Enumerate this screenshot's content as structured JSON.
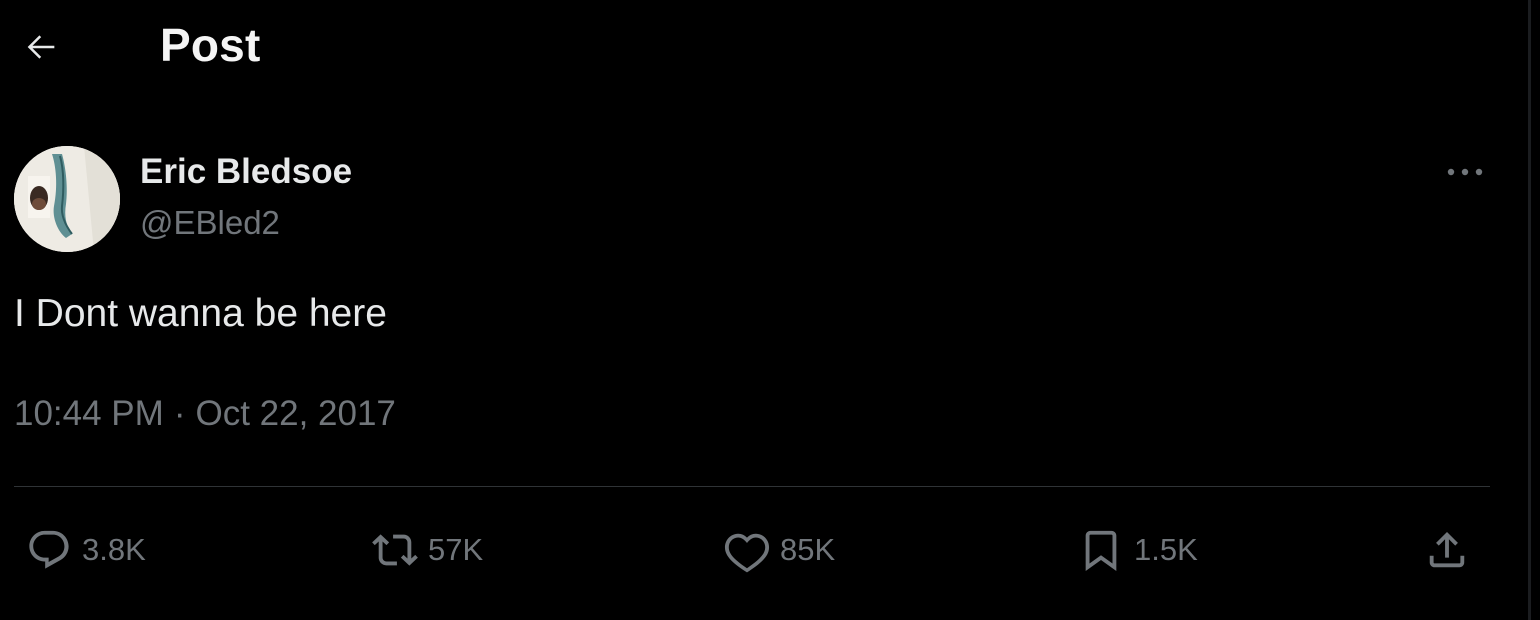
{
  "header": {
    "title": "Post",
    "back_icon": "arrow-left-icon"
  },
  "author": {
    "name": "Eric Bledsoe",
    "handle": "@EBled2",
    "avatar_icon": "profile-photo"
  },
  "post": {
    "text": "I Dont wanna be here",
    "time": "10:44 PM",
    "separator": "·",
    "date": "Oct 22, 2017"
  },
  "actions": {
    "replies": {
      "icon": "reply-icon",
      "count": "3.8K"
    },
    "reposts": {
      "icon": "repost-icon",
      "count": "57K"
    },
    "likes": {
      "icon": "heart-icon",
      "count": "85K"
    },
    "bookmarks": {
      "icon": "bookmark-icon",
      "count": "1.5K"
    },
    "share": {
      "icon": "share-icon"
    }
  },
  "colors": {
    "background": "#000000",
    "primary_text": "#e7e9ea",
    "secondary_text": "#71767b",
    "divider": "#2f3336"
  }
}
